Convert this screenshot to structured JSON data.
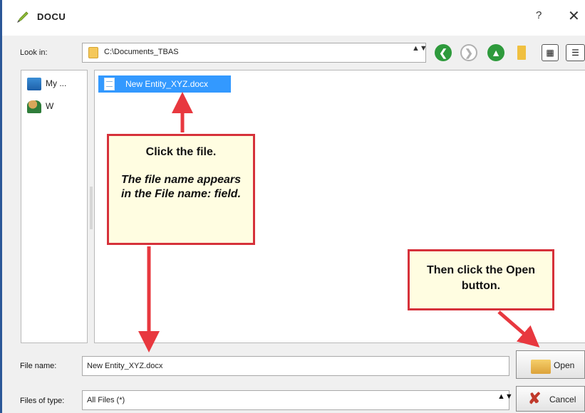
{
  "window": {
    "title": "DOCU",
    "help_glyph": "?",
    "close_glyph": "✕"
  },
  "look_in": {
    "label": "Look in:",
    "value": "C:\\Documents_TBAS",
    "arrows": "▲▼"
  },
  "toolbar": {
    "back_glyph": "❮",
    "forward_glyph": "❯",
    "up_glyph": "▲",
    "list_view_glyph": "▦",
    "detail_view_glyph": "☰"
  },
  "sidebar": {
    "items": [
      {
        "label": "My ...",
        "icon": "computer-icon"
      },
      {
        "label": "W",
        "icon": "user-folder-icon"
      }
    ]
  },
  "files": [
    {
      "name": "New Entity_XYZ.docx",
      "selected": true,
      "icon": "docx-file-icon"
    }
  ],
  "callouts": {
    "first_heading": "Click the file.",
    "first_body": "The file name appears in the File name: field.",
    "second_body": "Then click the Open button."
  },
  "file_name": {
    "label": "File name:",
    "value": "New Entity_XYZ.docx"
  },
  "file_type": {
    "label": "Files of type:",
    "value": "All Files (*)",
    "arrows": "▲▼"
  },
  "buttons": {
    "open": "Open",
    "cancel": "Cancel",
    "cancel_glyph": "✘"
  },
  "colors": {
    "selection": "#3399ff",
    "callout_border": "#d6313a",
    "callout_fill": "#fffde1",
    "nav_green": "#2e9a3c"
  }
}
